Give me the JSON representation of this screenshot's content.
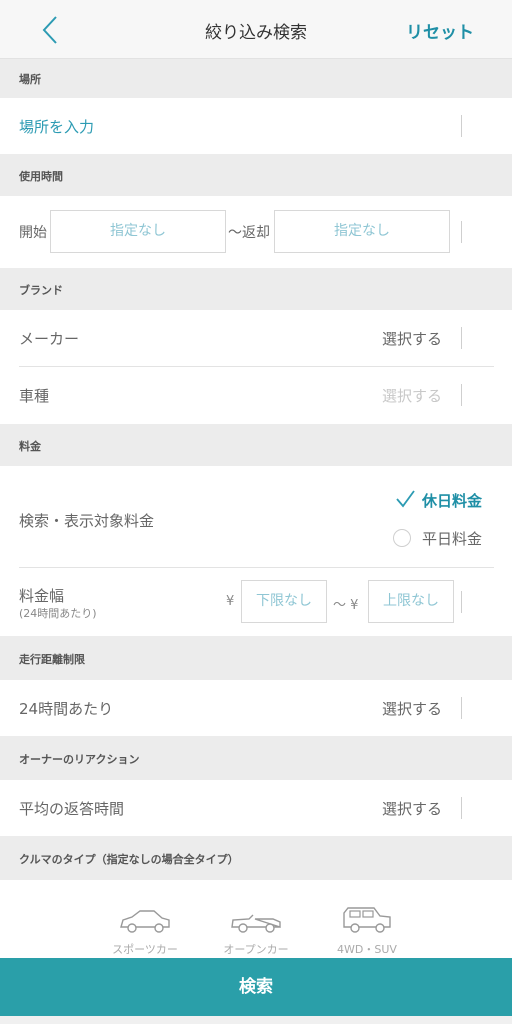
{
  "nav": {
    "title": "絞り込み検索",
    "reset": "リセット"
  },
  "sections": {
    "location": "場所",
    "time": "使用時間",
    "brand": "ブランド",
    "price": "料金",
    "mileage": "走行距離制限",
    "owner": "オーナーのリアクション",
    "car_type": "クルマのタイプ（指定なしの場合全タイプ）"
  },
  "location": {
    "input_label": "場所を入力"
  },
  "time": {
    "start_label": "開始",
    "start_value": "指定なし",
    "return_label": "〜返却",
    "return_value": "指定なし"
  },
  "brand": {
    "maker_label": "メーカー",
    "maker_action": "選択する",
    "model_label": "車種",
    "model_action": "選択する"
  },
  "price": {
    "target_label": "検索・表示対象料金",
    "holiday_label": "休日料金",
    "weekday_label": "平日料金",
    "holiday_checked": true,
    "range_label": "料金幅",
    "range_sub": "(24時間あたり)",
    "yen1": "¥",
    "lower_value": "下限なし",
    "tilde_yen": "〜 ¥",
    "upper_value": "上限なし"
  },
  "mileage": {
    "label": "24時間あたり",
    "action": "選択する"
  },
  "owner": {
    "label": "平均の返答時間",
    "action": "選択する"
  },
  "car_types": [
    {
      "label": "スポーツカー",
      "icon": "sports-car-icon"
    },
    {
      "label": "オープンカー",
      "icon": "convertible-icon"
    },
    {
      "label": "4WD・SUV",
      "icon": "suv-icon"
    }
  ],
  "search_button": "検索",
  "colors": {
    "accent": "#1f8fa6",
    "button": "#2a9fa9",
    "section_bg": "#ececec"
  }
}
